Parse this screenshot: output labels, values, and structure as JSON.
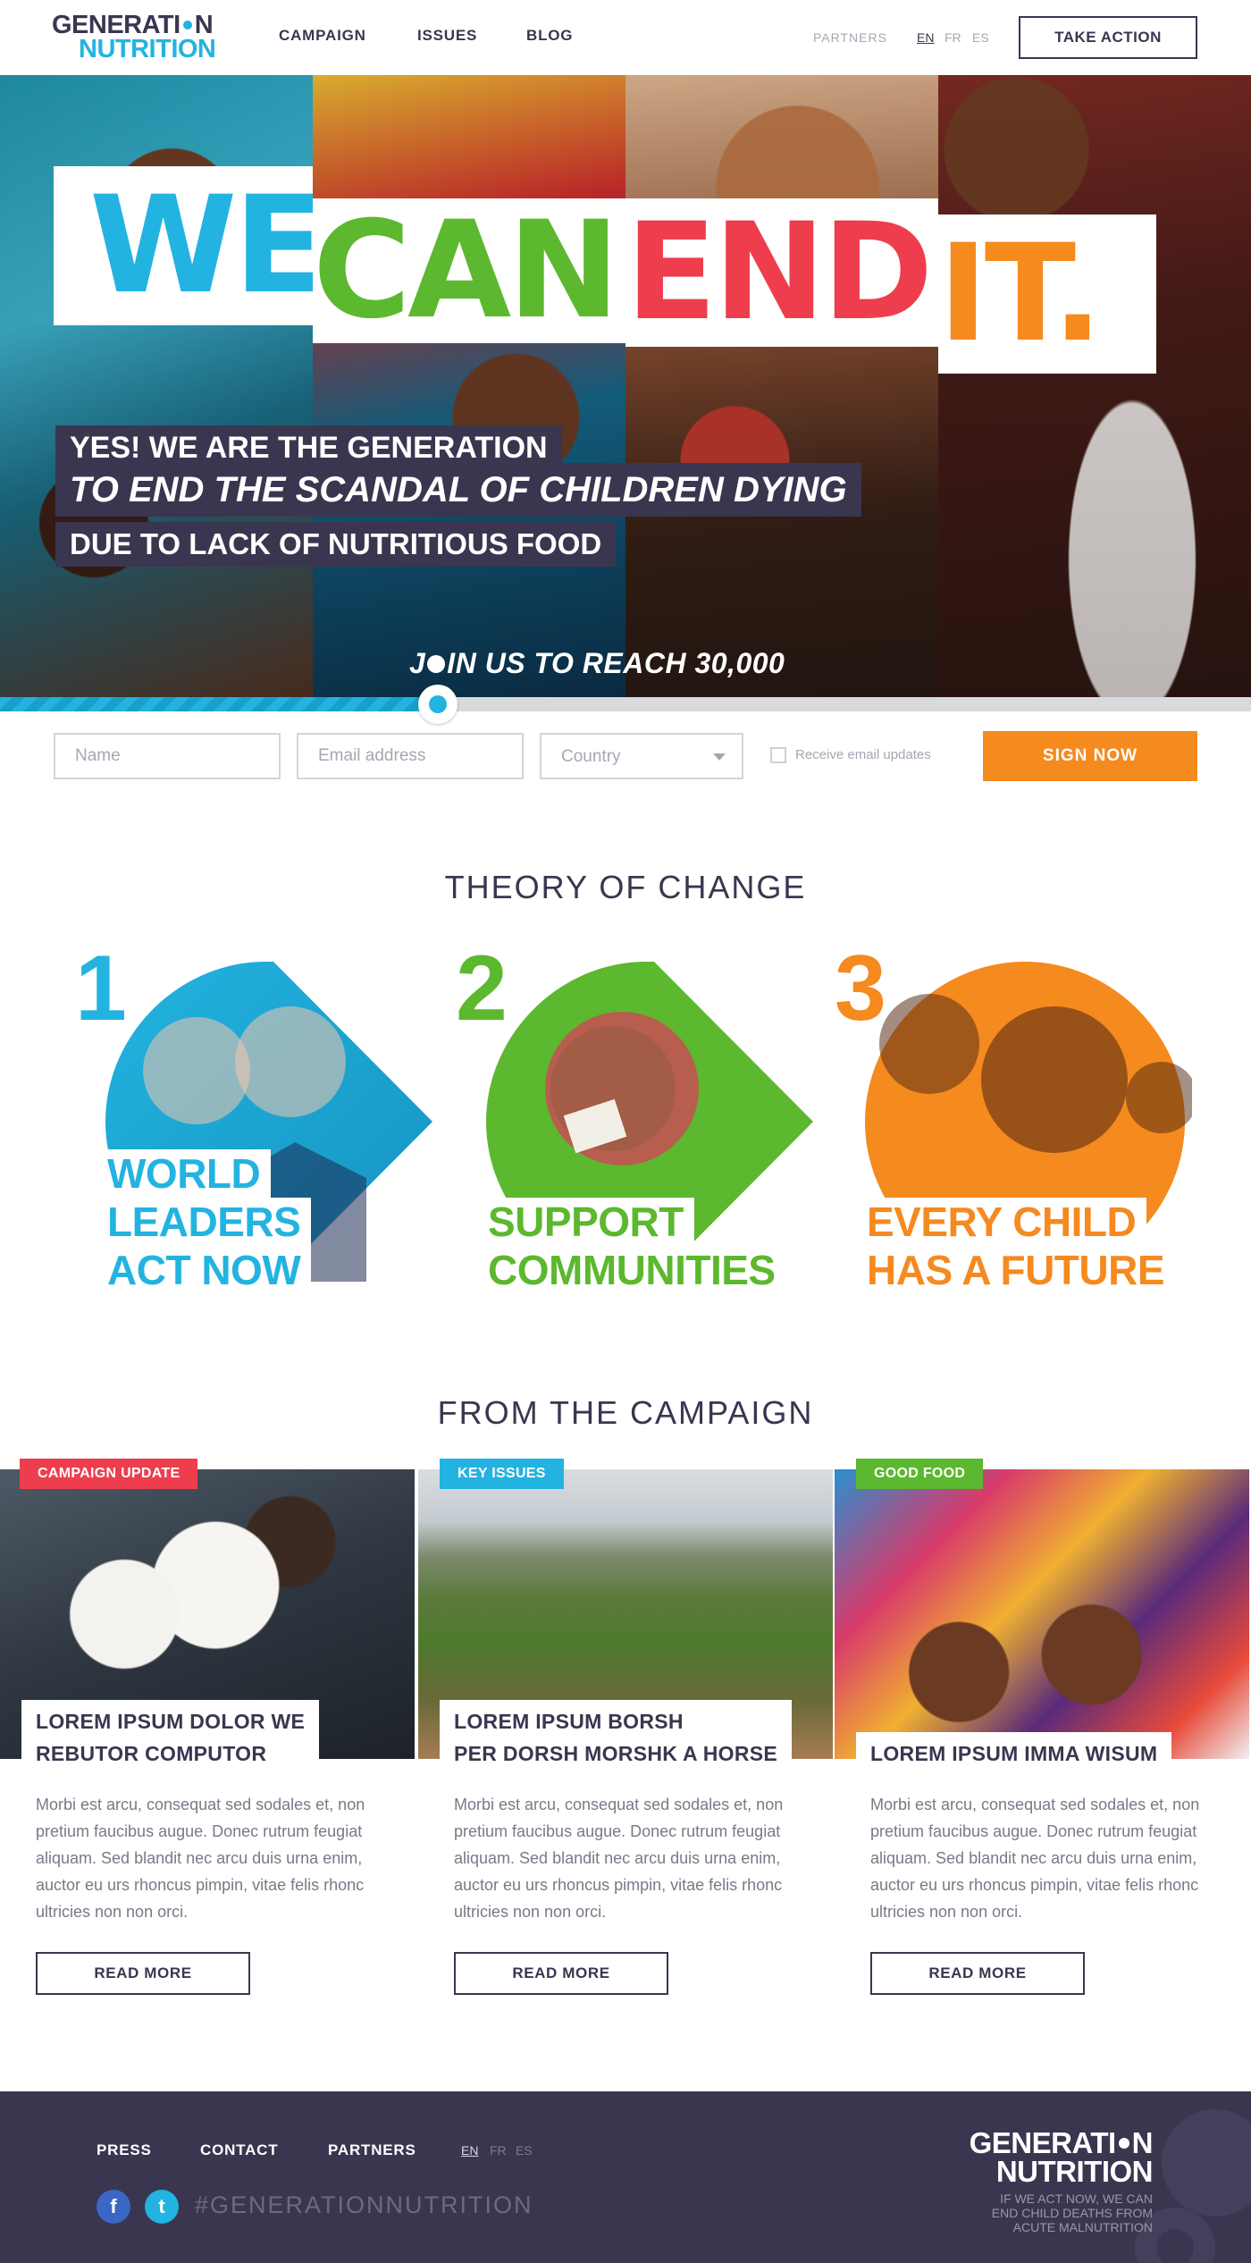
{
  "header": {
    "logo_line1": "GENERATI",
    "logo_line1_end": "N",
    "logo_line2": "NUTRITION",
    "nav": [
      "CAMPAIGN",
      "ISSUES",
      "BLOG"
    ],
    "partners": "PARTNERS",
    "languages": [
      "EN",
      "FR",
      "ES"
    ],
    "active_language": "EN",
    "cta": "TAKE ACTION"
  },
  "hero": {
    "words": [
      "WE",
      "CAN",
      "END",
      "IT."
    ],
    "word_colors": [
      "#23b3e0",
      "#5cb82e",
      "#ee3e4e",
      "#f58a1f"
    ],
    "tagline": [
      "YES! WE ARE THE GENERATION",
      "TO END THE SCANDAL OF CHILDREN DYING",
      "DUE TO LACK OF NUTRITIOUS FOOD"
    ],
    "join_prefix": "J",
    "join_rest": "IN US TO REACH 30,000",
    "progress_fraction": 0.35
  },
  "signup": {
    "name_placeholder": "Name",
    "email_placeholder": "Email address",
    "country_placeholder": "Country",
    "updates_label": "Receive email updates",
    "updates_checked": false,
    "submit": "SIGN NOW"
  },
  "theory": {
    "title": "THEORY OF CHANGE",
    "steps": [
      {
        "number": "1",
        "lines": [
          "WORLD",
          "LEADERS",
          "ACT NOW"
        ],
        "color": "#23b3e0"
      },
      {
        "number": "2",
        "lines": [
          "SUPPORT",
          "COMMUNITIES"
        ],
        "color": "#5cb82e"
      },
      {
        "number": "3",
        "lines": [
          "EVERY CHILD",
          "HAS A FUTURE"
        ],
        "color": "#f58a1f"
      }
    ]
  },
  "campaign": {
    "title": "FROM THE CAMPAIGN",
    "cards": [
      {
        "badge": "CAMPAIGN UPDATE",
        "badge_color": "#ee3e4e",
        "title_lines": [
          "LOREM IPSUM DOLOR WE",
          "REBUTOR COMPUTOR"
        ],
        "body": "Morbi est arcu, consequat sed sodales et, non pretium faucibus augue. Donec rutrum feugiat aliquam. Sed blandit nec arcu duis urna enim, auctor eu urs rhoncus pimpin, vitae felis rhonc ultricies non non orci.",
        "button": "READ MORE"
      },
      {
        "badge": "KEY ISSUES",
        "badge_color": "#23b3e0",
        "title_lines": [
          "LOREM IPSUM BORSH",
          "PER DORSH MORSHK A HORSE"
        ],
        "body": "Morbi est arcu, consequat sed sodales et, non pretium faucibus augue. Donec rutrum feugiat aliquam. Sed blandit nec arcu duis urna enim, auctor eu urs rhoncus pimpin, vitae felis rhonc ultricies non non orci.",
        "button": "READ MORE"
      },
      {
        "badge": "GOOD FOOD",
        "badge_color": "#5cb82e",
        "title_lines": [
          "LOREM IPSUM IMMA WISUM"
        ],
        "body": "Morbi est arcu, consequat sed sodales et, non pretium faucibus augue. Donec rutrum feugiat aliquam. Sed blandit nec arcu duis urna enim, auctor eu urs rhoncus pimpin, vitae felis rhonc ultricies non non orci.",
        "button": "READ MORE"
      }
    ]
  },
  "footer": {
    "links": [
      "PRESS",
      "CONTACT",
      "PARTNERS"
    ],
    "languages": [
      "EN",
      "FR",
      "ES"
    ],
    "active_language": "EN",
    "social": [
      "facebook-icon",
      "twitter-icon"
    ],
    "social_glyphs": [
      "f",
      "t"
    ],
    "hashtag": "#GENERATIONNUTRITION",
    "logo_line1": "GENERATI",
    "logo_line1_end": "N",
    "logo_line2": "NUTRITION",
    "tagline": "IF WE ACT NOW, WE CAN END CHILD DEATHS FROM ACUTE MALNUTRITION"
  }
}
